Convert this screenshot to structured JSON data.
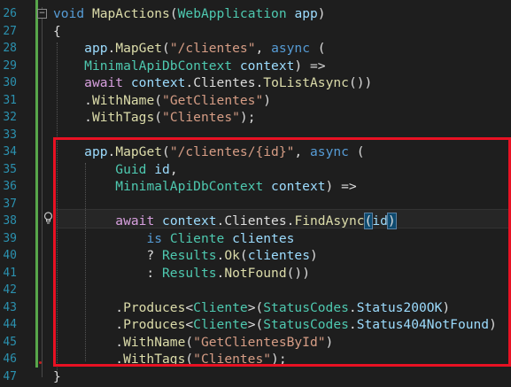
{
  "colors": {
    "background": "#1e1e1e",
    "line_number": "#2b91af",
    "keyword": "#569cd6",
    "control_keyword": "#d8a0df",
    "type": "#4ec9b0",
    "method": "#dcdcaa",
    "string": "#d69d85",
    "variable": "#9cdcfe",
    "plain": "#dcdcdc",
    "highlight_box": "#e81123",
    "change_bar": "#57a64a"
  },
  "icons": {
    "fold": "collapse-minus-icon",
    "lightbulb": "quick-actions-lightbulb-icon"
  },
  "lines": [
    {
      "num": "26",
      "tokens": [
        {
          "t": "void",
          "c": "keyword"
        },
        {
          "t": " ",
          "c": "plain"
        },
        {
          "t": "MapActions",
          "c": "method"
        },
        {
          "t": "(",
          "c": "plain"
        },
        {
          "t": "WebApplication",
          "c": "type"
        },
        {
          "t": " ",
          "c": "plain"
        },
        {
          "t": "app",
          "c": "variable"
        },
        {
          "t": ")",
          "c": "plain"
        }
      ]
    },
    {
      "num": "27",
      "tokens": [
        {
          "t": "{",
          "c": "plain"
        }
      ]
    },
    {
      "num": "28",
      "tokens": [
        {
          "t": "    ",
          "c": "plain"
        },
        {
          "t": "app",
          "c": "variable"
        },
        {
          "t": ".",
          "c": "plain"
        },
        {
          "t": "MapGet",
          "c": "method"
        },
        {
          "t": "(",
          "c": "plain"
        },
        {
          "t": "\"/clientes\"",
          "c": "string"
        },
        {
          "t": ", ",
          "c": "plain"
        },
        {
          "t": "async",
          "c": "keyword"
        },
        {
          "t": " (",
          "c": "plain"
        }
      ]
    },
    {
      "num": "29",
      "tokens": [
        {
          "t": "    ",
          "c": "plain"
        },
        {
          "t": "MinimalApiDbContext",
          "c": "type"
        },
        {
          "t": " ",
          "c": "plain"
        },
        {
          "t": "context",
          "c": "variable"
        },
        {
          "t": ") =>",
          "c": "plain"
        }
      ]
    },
    {
      "num": "30",
      "tokens": [
        {
          "t": "    ",
          "c": "plain"
        },
        {
          "t": "await",
          "c": "control_keyword"
        },
        {
          "t": " ",
          "c": "plain"
        },
        {
          "t": "context",
          "c": "variable"
        },
        {
          "t": ".",
          "c": "plain"
        },
        {
          "t": "Clientes",
          "c": "plain"
        },
        {
          "t": ".",
          "c": "plain"
        },
        {
          "t": "ToListAsync",
          "c": "method"
        },
        {
          "t": "())",
          "c": "plain"
        }
      ]
    },
    {
      "num": "31",
      "tokens": [
        {
          "t": "    .",
          "c": "plain"
        },
        {
          "t": "WithName",
          "c": "method"
        },
        {
          "t": "(",
          "c": "plain"
        },
        {
          "t": "\"GetClientes\"",
          "c": "string"
        },
        {
          "t": ")",
          "c": "plain"
        }
      ]
    },
    {
      "num": "32",
      "tokens": [
        {
          "t": "    .",
          "c": "plain"
        },
        {
          "t": "WithTags",
          "c": "method"
        },
        {
          "t": "(",
          "c": "plain"
        },
        {
          "t": "\"Clientes\"",
          "c": "string"
        },
        {
          "t": ");",
          "c": "plain"
        }
      ]
    },
    {
      "num": "33",
      "tokens": []
    },
    {
      "num": "34",
      "tokens": [
        {
          "t": "    ",
          "c": "plain"
        },
        {
          "t": "app",
          "c": "variable"
        },
        {
          "t": ".",
          "c": "plain"
        },
        {
          "t": "MapGet",
          "c": "method"
        },
        {
          "t": "(",
          "c": "plain"
        },
        {
          "t": "\"/clientes/{id}\"",
          "c": "string"
        },
        {
          "t": ", ",
          "c": "plain"
        },
        {
          "t": "async",
          "c": "keyword"
        },
        {
          "t": " (",
          "c": "plain"
        }
      ]
    },
    {
      "num": "35",
      "tokens": [
        {
          "t": "        ",
          "c": "plain"
        },
        {
          "t": "Guid",
          "c": "type"
        },
        {
          "t": " ",
          "c": "plain"
        },
        {
          "t": "id",
          "c": "variable"
        },
        {
          "t": ",",
          "c": "plain"
        }
      ]
    },
    {
      "num": "36",
      "tokens": [
        {
          "t": "        ",
          "c": "plain"
        },
        {
          "t": "MinimalApiDbContext",
          "c": "type"
        },
        {
          "t": " ",
          "c": "plain"
        },
        {
          "t": "context",
          "c": "variable"
        },
        {
          "t": ") =>",
          "c": "plain"
        }
      ]
    },
    {
      "num": "37",
      "tokens": []
    },
    {
      "num": "38",
      "tokens": [
        {
          "t": "        ",
          "c": "plain"
        },
        {
          "t": "await",
          "c": "control_keyword"
        },
        {
          "t": " ",
          "c": "plain"
        },
        {
          "t": "context",
          "c": "variable"
        },
        {
          "t": ".",
          "c": "plain"
        },
        {
          "t": "Clientes",
          "c": "plain"
        },
        {
          "t": ".",
          "c": "plain"
        },
        {
          "t": "FindAsync",
          "c": "method"
        },
        {
          "t": "(",
          "c": "plain",
          "match": true
        },
        {
          "t": "id",
          "c": "variable"
        },
        {
          "t": ")",
          "c": "plain",
          "match": true
        }
      ]
    },
    {
      "num": "39",
      "tokens": [
        {
          "t": "            ",
          "c": "plain"
        },
        {
          "t": "is",
          "c": "keyword"
        },
        {
          "t": " ",
          "c": "plain"
        },
        {
          "t": "Cliente",
          "c": "type"
        },
        {
          "t": " ",
          "c": "plain"
        },
        {
          "t": "clientes",
          "c": "variable"
        }
      ]
    },
    {
      "num": "40",
      "tokens": [
        {
          "t": "            ? ",
          "c": "plain"
        },
        {
          "t": "Results",
          "c": "type"
        },
        {
          "t": ".",
          "c": "plain"
        },
        {
          "t": "Ok",
          "c": "method"
        },
        {
          "t": "(",
          "c": "plain"
        },
        {
          "t": "clientes",
          "c": "variable"
        },
        {
          "t": ")",
          "c": "plain"
        }
      ]
    },
    {
      "num": "41",
      "tokens": [
        {
          "t": "            : ",
          "c": "plain"
        },
        {
          "t": "Results",
          "c": "type"
        },
        {
          "t": ".",
          "c": "plain"
        },
        {
          "t": "NotFound",
          "c": "method"
        },
        {
          "t": "())",
          "c": "plain"
        }
      ]
    },
    {
      "num": "42",
      "tokens": []
    },
    {
      "num": "43",
      "tokens": [
        {
          "t": "        .",
          "c": "plain"
        },
        {
          "t": "Produces",
          "c": "method"
        },
        {
          "t": "<",
          "c": "plain"
        },
        {
          "t": "Cliente",
          "c": "type"
        },
        {
          "t": ">(",
          "c": "plain"
        },
        {
          "t": "StatusCodes",
          "c": "type"
        },
        {
          "t": ".",
          "c": "plain"
        },
        {
          "t": "Status200OK",
          "c": "variable"
        },
        {
          "t": ")",
          "c": "plain"
        }
      ]
    },
    {
      "num": "44",
      "tokens": [
        {
          "t": "        .",
          "c": "plain"
        },
        {
          "t": "Produces",
          "c": "method"
        },
        {
          "t": "<",
          "c": "plain"
        },
        {
          "t": "Cliente",
          "c": "type"
        },
        {
          "t": ">(",
          "c": "plain"
        },
        {
          "t": "StatusCodes",
          "c": "type"
        },
        {
          "t": ".",
          "c": "plain"
        },
        {
          "t": "Status404NotFound",
          "c": "variable"
        },
        {
          "t": ")",
          "c": "plain"
        }
      ]
    },
    {
      "num": "45",
      "tokens": [
        {
          "t": "        .",
          "c": "plain"
        },
        {
          "t": "WithName",
          "c": "method"
        },
        {
          "t": "(",
          "c": "plain"
        },
        {
          "t": "\"GetClientesById\"",
          "c": "string"
        },
        {
          "t": ")",
          "c": "plain"
        }
      ]
    },
    {
      "num": "46",
      "tokens": [
        {
          "t": "        .",
          "c": "plain"
        },
        {
          "t": "WithTags",
          "c": "method"
        },
        {
          "t": "(",
          "c": "plain"
        },
        {
          "t": "\"Clientes\"",
          "c": "string"
        },
        {
          "t": ");",
          "c": "plain"
        }
      ]
    },
    {
      "num": "47",
      "tokens": [
        {
          "t": "}",
          "c": "plain"
        }
      ]
    }
  ]
}
